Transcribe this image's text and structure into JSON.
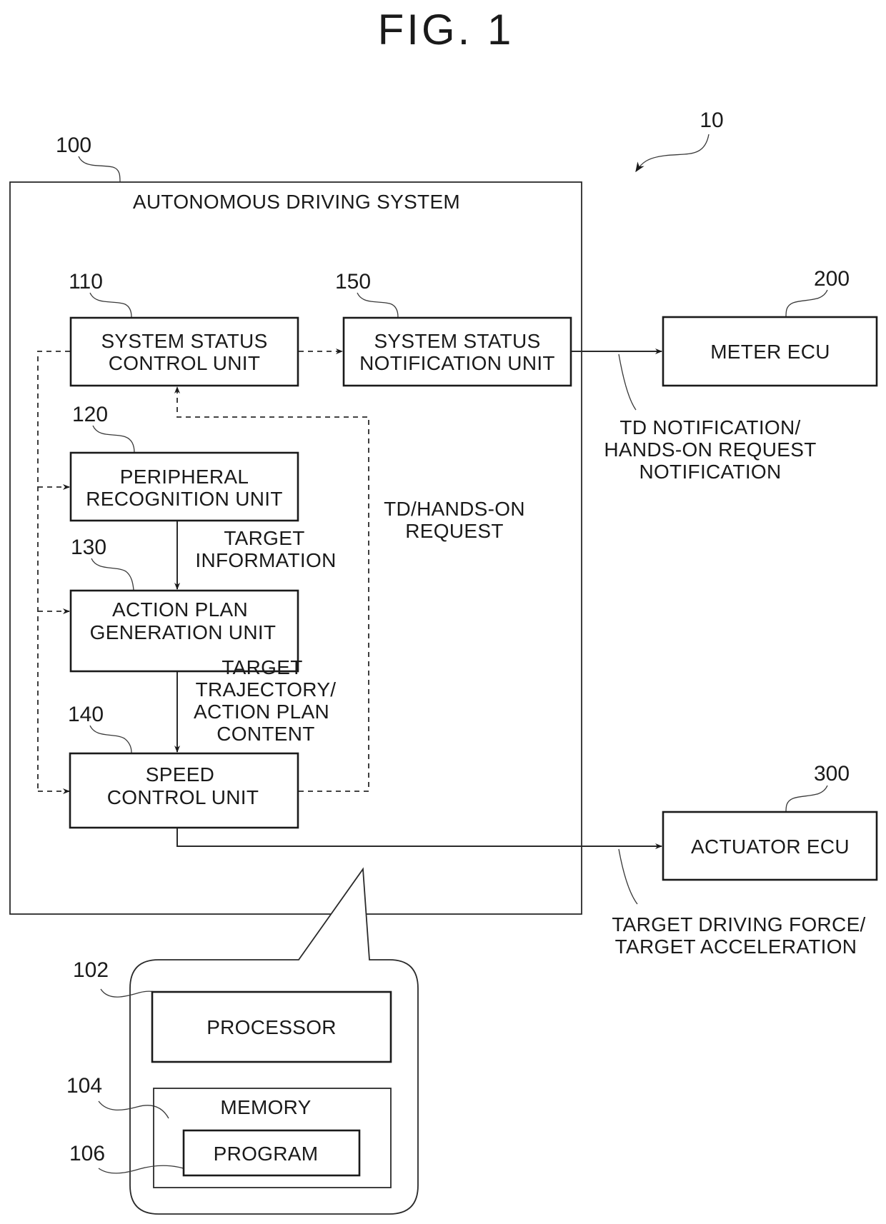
{
  "figure": {
    "title": "FIG. 1",
    "system_ref": "10"
  },
  "autonomous_driving_system": {
    "ref": "100",
    "label": "AUTONOMOUS DRIVING SYSTEM",
    "units": {
      "system_status_control": {
        "ref": "110",
        "lines": [
          "SYSTEM STATUS",
          "CONTROL UNIT"
        ]
      },
      "peripheral_recognition": {
        "ref": "120",
        "lines": [
          "PERIPHERAL",
          "RECOGNITION UNIT"
        ]
      },
      "action_plan_generation": {
        "ref": "130",
        "lines": [
          "ACTION PLAN",
          "GENERATION UNIT"
        ]
      },
      "speed_control": {
        "ref": "140",
        "lines": [
          "SPEED",
          "CONTROL UNIT"
        ]
      },
      "system_status_notification": {
        "ref": "150",
        "lines": [
          "SYSTEM STATUS",
          "NOTIFICATION UNIT"
        ]
      }
    },
    "hardware": {
      "processor": {
        "ref": "102",
        "label": "PROCESSOR"
      },
      "memory": {
        "ref": "104",
        "label": "MEMORY"
      },
      "program": {
        "ref": "106",
        "label": "PROGRAM"
      }
    }
  },
  "external": {
    "meter_ecu": {
      "ref": "200",
      "label": "METER ECU"
    },
    "actuator_ecu": {
      "ref": "300",
      "label": "ACTUATOR ECU"
    }
  },
  "signals": {
    "target_information": [
      "TARGET",
      "INFORMATION"
    ],
    "target_trajectory": [
      "TARGET",
      "TRAJECTORY/",
      "ACTION PLAN",
      "CONTENT"
    ],
    "td_hands_on_request": [
      "TD/HANDS-ON",
      "REQUEST"
    ],
    "td_notification": [
      "TD NOTIFICATION/",
      "HANDS-ON REQUEST",
      "NOTIFICATION"
    ],
    "target_driving_force": [
      "TARGET DRIVING FORCE/",
      "TARGET ACCELERATION"
    ]
  }
}
